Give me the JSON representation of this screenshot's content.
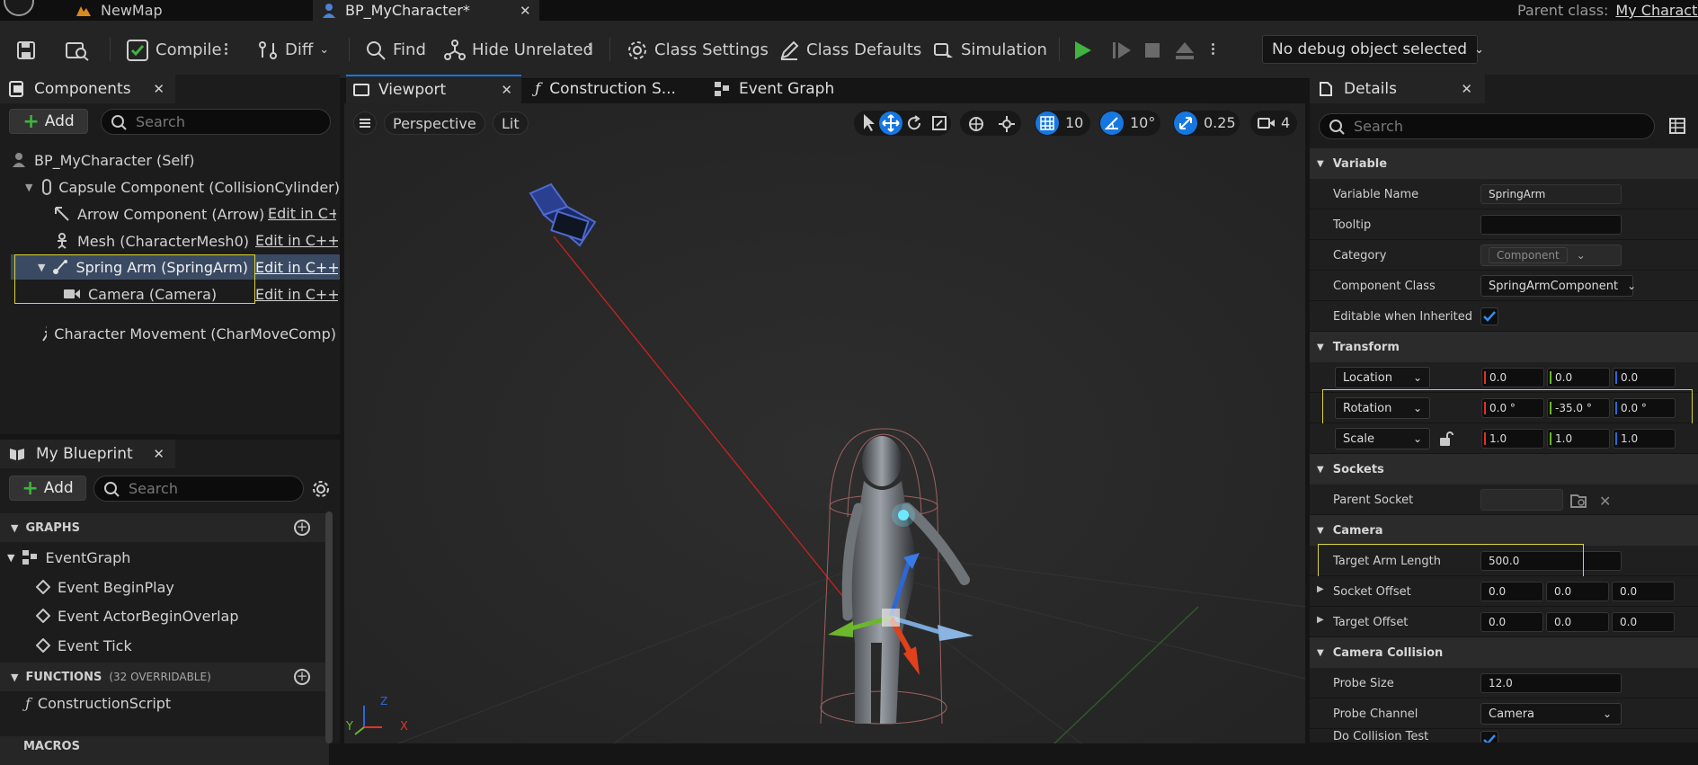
{
  "tabs": [
    {
      "label": "NewMap"
    },
    {
      "label": "BP_MyCharacter*"
    }
  ],
  "parent_class": {
    "label": "Parent class:",
    "value": "My Characte"
  },
  "toolbar": {
    "compile": "Compile",
    "diff": "Diff",
    "find": "Find",
    "hide_unrelated": "Hide Unrelated",
    "class_settings": "Class Settings",
    "class_defaults": "Class Defaults",
    "simulation": "Simulation",
    "debug_object": "No debug object selected"
  },
  "components": {
    "title": "Components",
    "add": "Add",
    "search_placeholder": "Search",
    "items": [
      {
        "label": "BP_MyCharacter (Self)"
      },
      {
        "label": "Capsule Component (CollisionCylinder)"
      },
      {
        "label": "Arrow Component (Arrow)",
        "edit": "Edit in C+"
      },
      {
        "label": "Mesh (CharacterMesh0)",
        "edit": "Edit in C++"
      },
      {
        "label": "Spring Arm (SpringArm)",
        "edit": "Edit in C++"
      },
      {
        "label": "Camera (Camera)",
        "edit": "Edit in C++"
      },
      {
        "label": "Character Movement (CharMoveComp)"
      }
    ]
  },
  "my_blueprint": {
    "title": "My Blueprint",
    "add": "Add",
    "search_placeholder": "Search",
    "graphs_header": "GRAPHS",
    "event_graph": "EventGraph",
    "events": [
      "Event BeginPlay",
      "Event ActorBeginOverlap",
      "Event Tick"
    ],
    "functions_header": "FUNCTIONS",
    "functions_count": "(32 OVERRIDABLE)",
    "construction_script": "ConstructionScript",
    "macros_header": "MACROS"
  },
  "editor_tabs": {
    "viewport": "Viewport",
    "construction": "Construction S...",
    "event_graph": "Event Graph"
  },
  "viewport_toolbar": {
    "perspective": "Perspective",
    "lit": "Lit",
    "grid_snap": "10",
    "rotation_snap": "10°",
    "scale_snap": "0.25",
    "camera_speed": "4",
    "axis_labels": {
      "x": "X",
      "y": "Y",
      "z": "Z"
    }
  },
  "details": {
    "title": "Details",
    "search_placeholder": "Search",
    "variable": {
      "header": "Variable",
      "variable_name_label": "Variable Name",
      "variable_name": "SpringArm",
      "tooltip_label": "Tooltip",
      "tooltip": "",
      "category_label": "Category",
      "category": "Component",
      "component_class_label": "Component Class",
      "component_class": "SpringArmComponent",
      "editable_label": "Editable when Inherited",
      "editable": true
    },
    "transform": {
      "header": "Transform",
      "location_label": "Location",
      "location": [
        "0.0",
        "0.0",
        "0.0"
      ],
      "rotation_label": "Rotation",
      "rotation": [
        "0.0 °",
        "-35.0 °",
        "0.0 °"
      ],
      "scale_label": "Scale",
      "scale": [
        "1.0",
        "1.0",
        "1.0"
      ]
    },
    "sockets": {
      "header": "Sockets",
      "parent_socket_label": "Parent Socket"
    },
    "camera": {
      "header": "Camera",
      "target_arm_length_label": "Target Arm Length",
      "target_arm_length": "500.0",
      "socket_offset_label": "Socket Offset",
      "socket_offset": [
        "0.0",
        "0.0",
        "0.0"
      ],
      "target_offset_label": "Target Offset",
      "target_offset": [
        "0.0",
        "0.0",
        "0.0"
      ]
    },
    "camera_collision": {
      "header": "Camera Collision",
      "probe_size_label": "Probe Size",
      "probe_size": "12.0",
      "probe_channel_label": "Probe Channel",
      "probe_channel": "Camera",
      "do_collision_label": "Do Collision Test",
      "do_collision": true
    }
  },
  "colors": {
    "accent": "#1677e0",
    "highlight": "#d9d23a",
    "play": "#3fb43f",
    "x_axis": "#e0312a",
    "y_axis": "#6cb72b",
    "z_axis": "#2d67d6"
  }
}
